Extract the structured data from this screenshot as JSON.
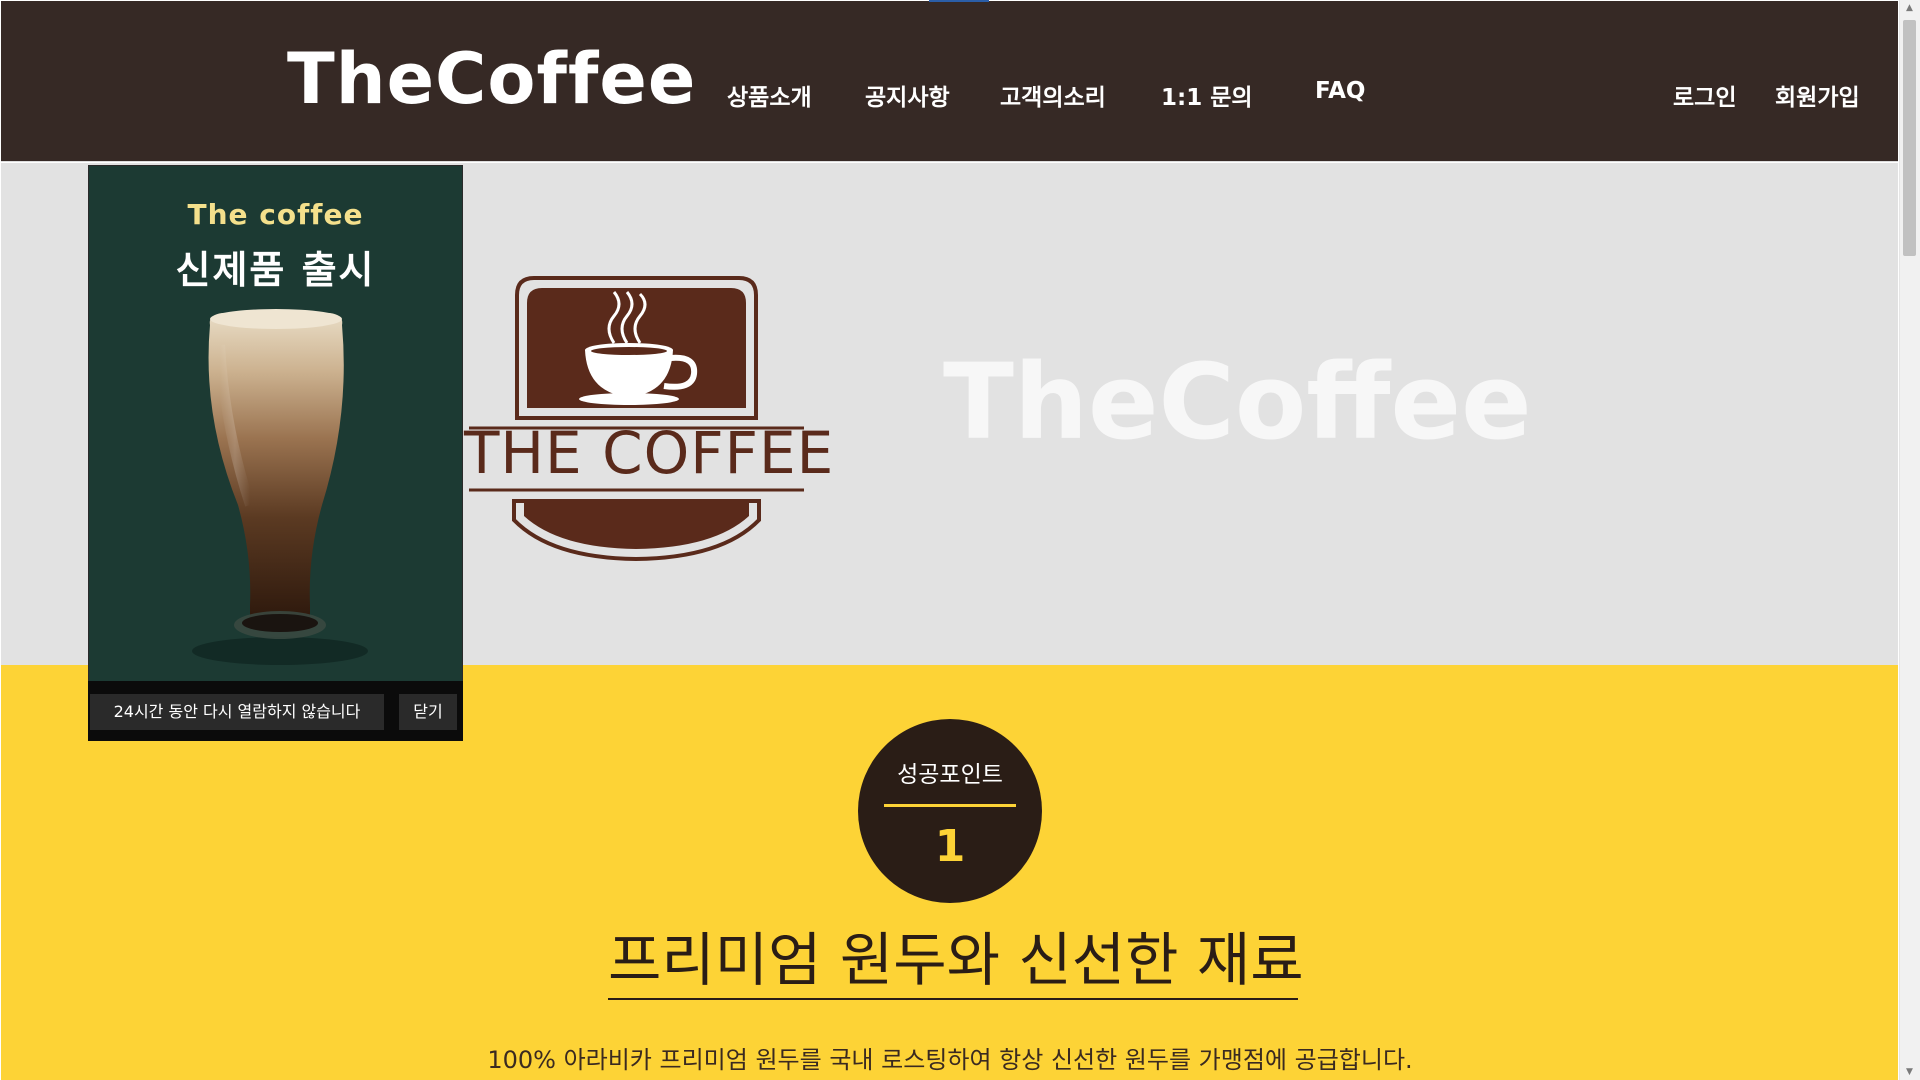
{
  "header": {
    "brand": "TheCoffee",
    "nav": {
      "products": "상품소개",
      "notices": "공지사항",
      "voice": "고객의소리",
      "inquiry": "1:1 문의",
      "faq": "FAQ"
    },
    "auth": {
      "login": "로그인",
      "signup": "회원가입"
    }
  },
  "hero": {
    "logo_text": "THE COFFEE",
    "wordmark": "TheCoffee"
  },
  "popup": {
    "kicker": "The coffee",
    "title": "신제품 출시",
    "dismiss_label": "24시간 동안 다시 열람하지 않습니다",
    "close_label": "닫기"
  },
  "feature": {
    "badge_label": "성공포인트",
    "badge_number": "1",
    "title": "프리미엄 원두와 신선한 재료",
    "description": "100% 아라비카 프리미엄 원두를 국내 로스팅하여 항상 신선한 원두를 가맹점에 공급합니다."
  },
  "colors": {
    "header_bg": "#362925",
    "hero_bg": "#e2e2e2",
    "accent_yellow": "#fdd336",
    "popup_bg": "#1c3a33",
    "logo_brown": "#5a2a1b",
    "badge_dark": "#2a1d16"
  },
  "icons": {
    "logo_emblem": "coffee-cup-emblem-icon",
    "scroll_up": "chevron-up-icon",
    "scroll_down": "chevron-down-icon"
  }
}
